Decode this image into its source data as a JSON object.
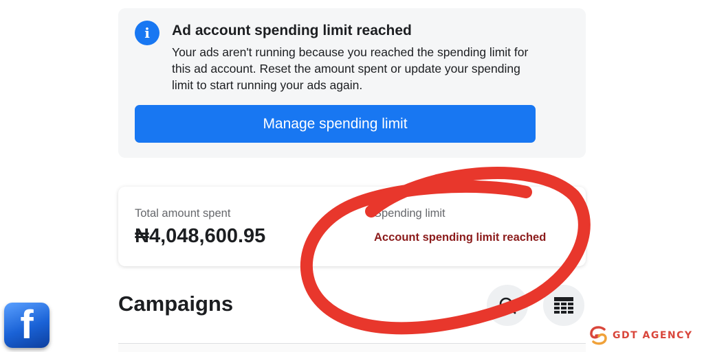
{
  "alert": {
    "icon": "info-icon",
    "icon_glyph": "i",
    "title": "Ad account spending limit reached",
    "body": "Your ads aren't running because you reached the spending limit for this ad account. Reset the amount spent or update your spending limit to start running your ads again.",
    "button_label": "Manage spending limit"
  },
  "stats": {
    "total_label": "Total amount spent",
    "total_value": "₦4,048,600.95",
    "limit_label": "Spending limit",
    "limit_status": "Account spending limit reached"
  },
  "campaigns": {
    "title": "Campaigns",
    "search_icon": "search-icon",
    "grid_icon": "grid-icon"
  },
  "overlay": {
    "annotation": "red-hand-drawn-circle",
    "fb_logo_glyph": "f",
    "agency_name": "GDT AGENCY"
  },
  "colors": {
    "primary": "#1877f2",
    "warning_text": "#8b1b1b",
    "annotation": "#e8372c",
    "card_bg": "#f5f6f7",
    "agency": "#d9463b"
  }
}
